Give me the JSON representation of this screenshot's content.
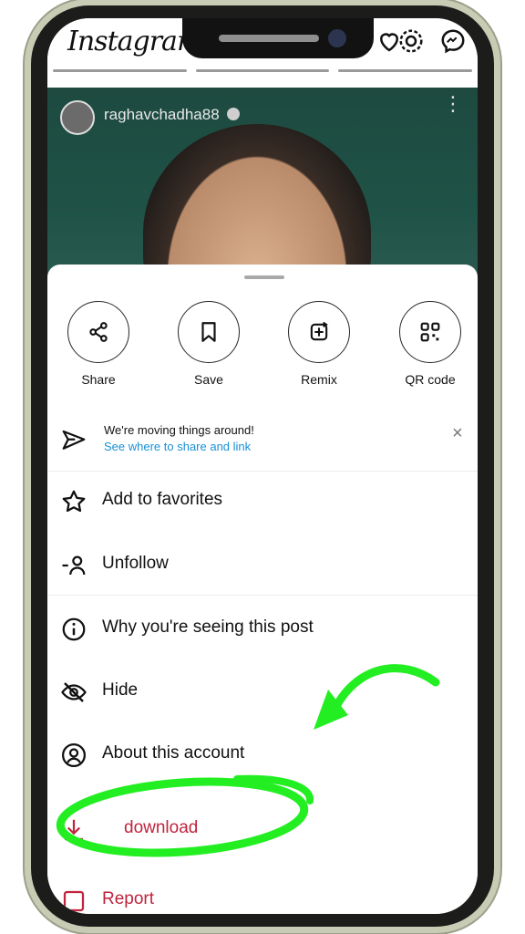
{
  "app": {
    "logo_text": "Instagram"
  },
  "post": {
    "username": "raghavchadha88",
    "more_label": "⋮"
  },
  "share_actions": [
    {
      "label": "Share",
      "icon": "share-icon"
    },
    {
      "label": "Save",
      "icon": "bookmark-icon"
    },
    {
      "label": "Remix",
      "icon": "remix-icon"
    },
    {
      "label": "QR code",
      "icon": "qr-code-icon"
    }
  ],
  "notice": {
    "title": "We're moving things around!",
    "link": "See where to share and link",
    "close": "×"
  },
  "menu": [
    {
      "label": "Add to favorites",
      "icon": "star-icon"
    },
    {
      "label": "Unfollow",
      "icon": "unfollow-icon"
    },
    {
      "label": "Why you're seeing this post",
      "icon": "info-icon"
    },
    {
      "label": "Hide",
      "icon": "hide-eye-icon"
    },
    {
      "label": "About this account",
      "icon": "account-icon"
    },
    {
      "label": "download",
      "icon": "download-icon"
    },
    {
      "label": "Report",
      "icon": "report-icon"
    }
  ],
  "colors": {
    "link": "#1a8fd6",
    "danger": "#c0243e",
    "annotation": "#22ee22"
  }
}
